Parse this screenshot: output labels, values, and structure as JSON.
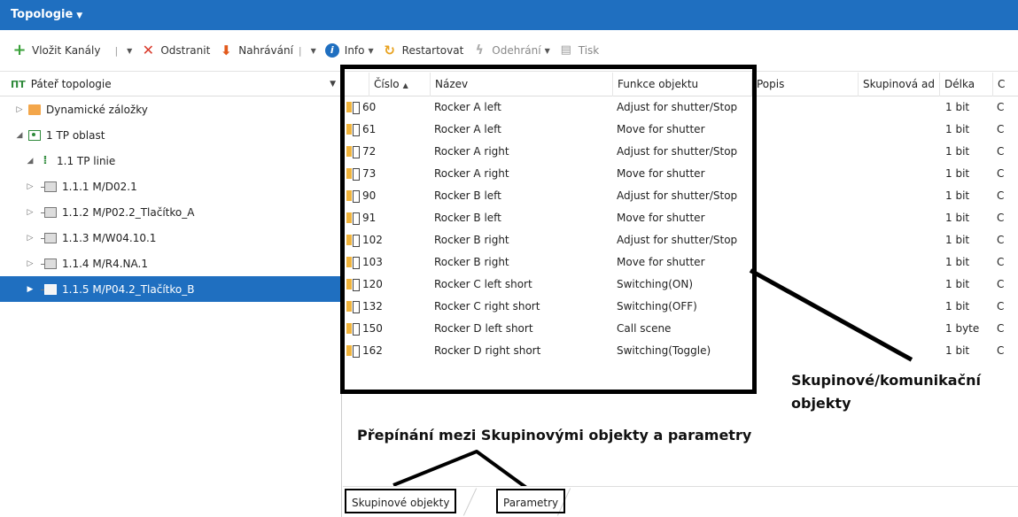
{
  "window": {
    "title": "Topologie"
  },
  "toolbar": {
    "insert_channels": "Vložit Kanály",
    "remove": "Odstranit",
    "upload": "Nahrávání",
    "info": "Info",
    "restart": "Restartovat",
    "playback": "Odehrání",
    "print": "Tisk"
  },
  "tree": {
    "header": "Páteř topologie",
    "nodes": [
      {
        "label": "Dynamické záložky",
        "icon": "folder-icon"
      },
      {
        "label": "1 TP oblast",
        "icon": "area-icon"
      },
      {
        "label": "1.1 TP linie",
        "icon": "line-icon"
      },
      {
        "label": "1.1.1 M/D02.1",
        "icon": "device-icon"
      },
      {
        "label": "1.1.2 M/P02.2_Tlačítko_A",
        "icon": "device-icon"
      },
      {
        "label": "1.1.3 M/W04.10.1",
        "icon": "device-icon"
      },
      {
        "label": "1.1.4 M/R4.NA.1",
        "icon": "device-icon"
      },
      {
        "label": "1.1.5 M/P04.2_Tlačítko_B",
        "icon": "device-icon",
        "selected": true
      }
    ]
  },
  "grid": {
    "columns": [
      "Číslo",
      "Název",
      "Funkce objektu",
      "Popis",
      "Skupinová ad",
      "Délka",
      "C"
    ],
    "rows": [
      {
        "num": "60",
        "name": "Rocker A left",
        "func": "Adjust for shutter/Stop",
        "len": "1 bit",
        "c": "C"
      },
      {
        "num": "61",
        "name": "Rocker A left",
        "func": "Move for shutter",
        "len": "1 bit",
        "c": "C"
      },
      {
        "num": "72",
        "name": "Rocker A right",
        "func": "Adjust for shutter/Stop",
        "len": "1 bit",
        "c": "C"
      },
      {
        "num": "73",
        "name": "Rocker A right",
        "func": "Move for shutter",
        "len": "1 bit",
        "c": "C"
      },
      {
        "num": "90",
        "name": "Rocker B left",
        "func": "Adjust for shutter/Stop",
        "len": "1 bit",
        "c": "C"
      },
      {
        "num": "91",
        "name": "Rocker B left",
        "func": "Move for shutter",
        "len": "1 bit",
        "c": "C"
      },
      {
        "num": "102",
        "name": "Rocker B right",
        "func": "Adjust for shutter/Stop",
        "len": "1 bit",
        "c": "C"
      },
      {
        "num": "103",
        "name": "Rocker B right",
        "func": "Move for shutter",
        "len": "1 bit",
        "c": "C"
      },
      {
        "num": "120",
        "name": "Rocker C left short",
        "func": "Switching(ON)",
        "len": "1 bit",
        "c": "C"
      },
      {
        "num": "132",
        "name": "Rocker C right short",
        "func": "Switching(OFF)",
        "len": "1 bit",
        "c": "C"
      },
      {
        "num": "150",
        "name": "Rocker D left short",
        "func": "Call scene",
        "len": "1 byte",
        "c": "C"
      },
      {
        "num": "162",
        "name": "Rocker D right short",
        "func": "Switching(Toggle)",
        "len": "1 bit",
        "c": "C"
      }
    ]
  },
  "annotations": {
    "objects_label_line1": "Skupinové/komunikační",
    "objects_label_line2": "objekty",
    "switch_label": "Přepínání mezi Skupinovými objekty a parametry"
  },
  "tabs": {
    "group_objects": "Skupinové objekty",
    "parameters": "Parametry"
  }
}
